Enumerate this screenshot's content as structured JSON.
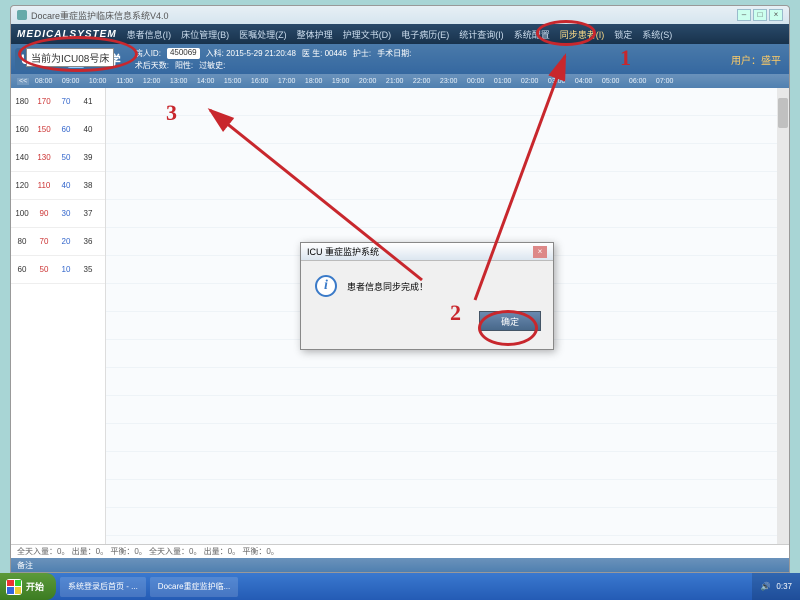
{
  "titlebar": {
    "title": "Docare重症监护临床信息系统V4.0"
  },
  "menus": [
    "患者信息(I)",
    "床位管理(B)",
    "医嘱处理(Z)",
    "整体护理",
    "护理文书(D)",
    "电子病历(E)",
    "统计查询(I)",
    "系统配置",
    "同步患者(I)",
    "锁定",
    "系统(S)"
  ],
  "bed": {
    "label": "U08",
    "suffix": "床"
  },
  "patient_name": "周X学",
  "info": {
    "r1": {
      "a": "病人ID:",
      "av": "450069",
      "b": "入科: 2015-5-29 21:20:48",
      "c": "医 生: 00446",
      "d": "护士:",
      "e": "手术日期:"
    },
    "r2": {
      "a": "术后天数:",
      "b": "阳性:",
      "c": "过敏史:"
    }
  },
  "user_label": "用户：盛平",
  "timeline_nav": {
    "prev": "<<",
    "next": ">>"
  },
  "timeline_hours": [
    "08:00",
    "09:00",
    "10:00",
    "11:00",
    "12:00",
    "13:00",
    "14:00",
    "15:00",
    "16:00",
    "17:00",
    "18:00",
    "19:00",
    "20:00",
    "21:00",
    "22:00",
    "23:00",
    "00:00",
    "01:00",
    "02:00",
    "03:00",
    "04:00",
    "05:00",
    "06:00",
    "07:00"
  ],
  "leftgrid_rows": [
    [
      "180",
      "170",
      "70",
      "41"
    ],
    [
      "160",
      "150",
      "60",
      "40"
    ],
    [
      "140",
      "130",
      "50",
      "39"
    ],
    [
      "120",
      "110",
      "40",
      "38"
    ],
    [
      "100",
      "90",
      "30",
      "37"
    ],
    [
      "80",
      "70",
      "20",
      "36"
    ],
    [
      "60",
      "50",
      "10",
      "35"
    ]
  ],
  "status_line": "全天入量：0。 出量：0。 平衡：0。    全天入量：0。 出量：0。 平衡：0。",
  "status_label": "备注",
  "dialog": {
    "title": "ICU 重症监护系统",
    "msg": "患者信息同步完成！",
    "ok": "确定"
  },
  "overlay_text": "当前为ICU08号床",
  "annotations": {
    "n1": "1",
    "n2": "2",
    "n3": "3"
  },
  "taskbar": {
    "start": "开始",
    "items": [
      "系统登录后首页 - ...",
      "Docare重症监护临..."
    ],
    "time": "0:37"
  }
}
